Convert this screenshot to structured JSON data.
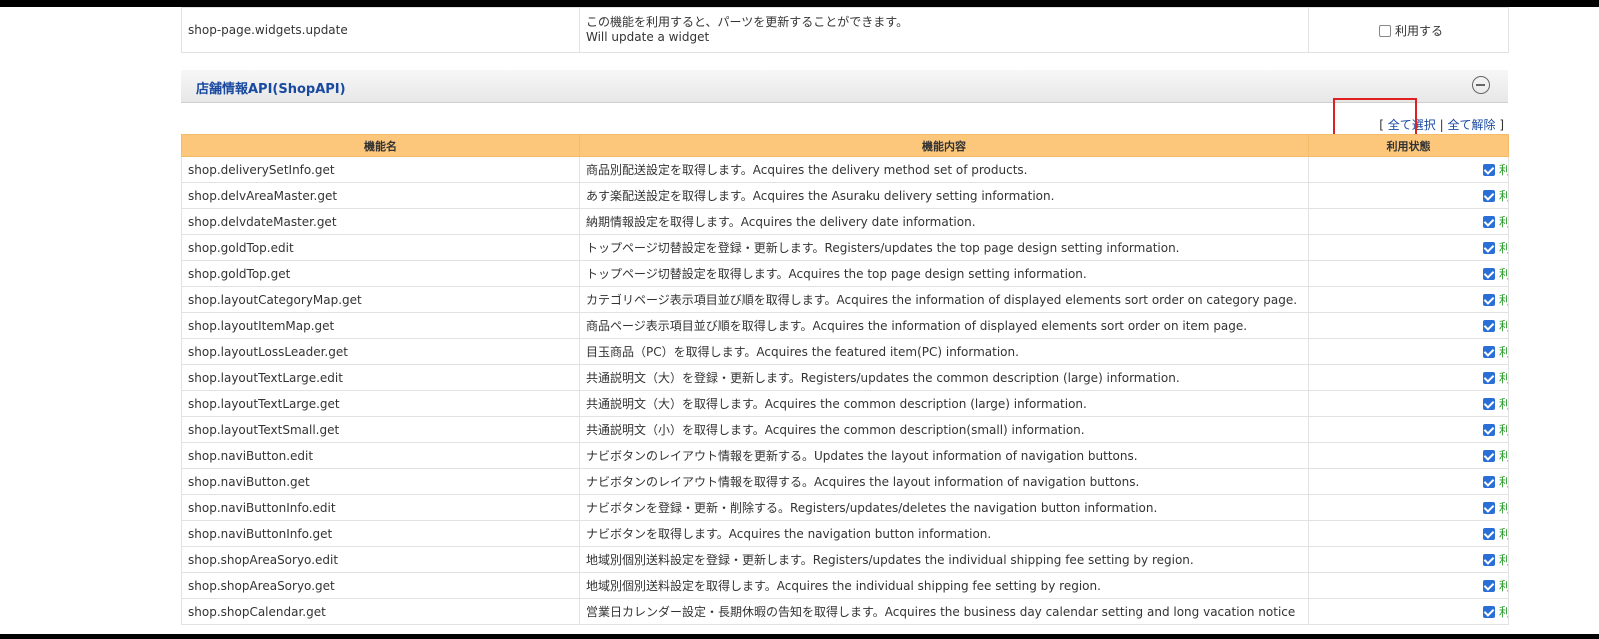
{
  "prev_section": {
    "row": {
      "name": "shop-page.widgets.update",
      "desc_ja": "この機能を利用すると、パーツを更新することができます。",
      "desc_en": "Will update a widget",
      "checkbox_label": "利用する"
    }
  },
  "section": {
    "title": "店舗情報API(ShopAPI)",
    "select_all": "全て選択",
    "deselect_all": "全て解除",
    "bracket_open": "[",
    "separator": "|",
    "bracket_close": "]"
  },
  "table": {
    "headers": [
      "機能名",
      "機能内容",
      "利用状態"
    ],
    "rows": [
      {
        "name": "shop.deliverySetInfo.get",
        "desc": "商品別配送設定を取得します。Acquires the delivery method set of products.",
        "status": "利用中"
      },
      {
        "name": "shop.delvAreaMaster.get",
        "desc": "あす楽配送設定を取得します。Acquires the Asuraku delivery setting information.",
        "status": "利用中"
      },
      {
        "name": "shop.delvdateMaster.get",
        "desc": "納期情報設定を取得します。Acquires the delivery date information.",
        "status": "利用中"
      },
      {
        "name": "shop.goldTop.edit",
        "desc": "トップページ切替設定を登録・更新します。Registers/updates the top page design setting information.",
        "status": "利用中"
      },
      {
        "name": "shop.goldTop.get",
        "desc": "トップページ切替設定を取得します。Acquires the top page design setting information.",
        "status": "利用中"
      },
      {
        "name": "shop.layoutCategoryMap.get",
        "desc": "カテゴリページ表示項目並び順を取得します。Acquires the information of displayed elements sort order on category page.",
        "status": "利用中"
      },
      {
        "name": "shop.layoutItemMap.get",
        "desc": "商品ページ表示項目並び順を取得します。Acquires the information of displayed elements sort order on item page.",
        "status": "利用中"
      },
      {
        "name": "shop.layoutLossLeader.get",
        "desc": "目玉商品（PC）を取得します。Acquires the featured item(PC) information.",
        "status": "利用中"
      },
      {
        "name": "shop.layoutTextLarge.edit",
        "desc": "共通説明文（大）を登録・更新します。Registers/updates the common description (large) information.",
        "status": "利用中"
      },
      {
        "name": "shop.layoutTextLarge.get",
        "desc": "共通説明文（大）を取得します。Acquires the common description (large) information.",
        "status": "利用中"
      },
      {
        "name": "shop.layoutTextSmall.get",
        "desc": "共通説明文（小）を取得します。Acquires the common description(small) information.",
        "status": "利用中"
      },
      {
        "name": "shop.naviButton.edit",
        "desc": "ナビボタンのレイアウト情報を更新する。Updates the layout information of navigation buttons.",
        "status": "利用中"
      },
      {
        "name": "shop.naviButton.get",
        "desc": "ナビボタンのレイアウト情報を取得する。Acquires the layout information of navigation buttons.",
        "status": "利用中"
      },
      {
        "name": "shop.naviButtonInfo.edit",
        "desc": "ナビボタンを登録・更新・削除する。Registers/updates/deletes the navigation button information.",
        "status": "利用中"
      },
      {
        "name": "shop.naviButtonInfo.get",
        "desc": "ナビボタンを取得します。Acquires the navigation button information.",
        "status": "利用中"
      },
      {
        "name": "shop.shopAreaSoryo.edit",
        "desc": "地域別個別送料設定を登録・更新します。Registers/updates the individual shipping fee setting by region.",
        "status": "利用中"
      },
      {
        "name": "shop.shopAreaSoryo.get",
        "desc": "地域別個別送料設定を取得します。Acquires the individual shipping fee setting by region.",
        "status": "利用中"
      },
      {
        "name": "shop.shopCalendar.get",
        "desc": "営業日カレンダー設定・長期休暇の告知を取得します。Acquires the business day calendar setting and long vacation notice",
        "status": "利用中"
      }
    ]
  }
}
